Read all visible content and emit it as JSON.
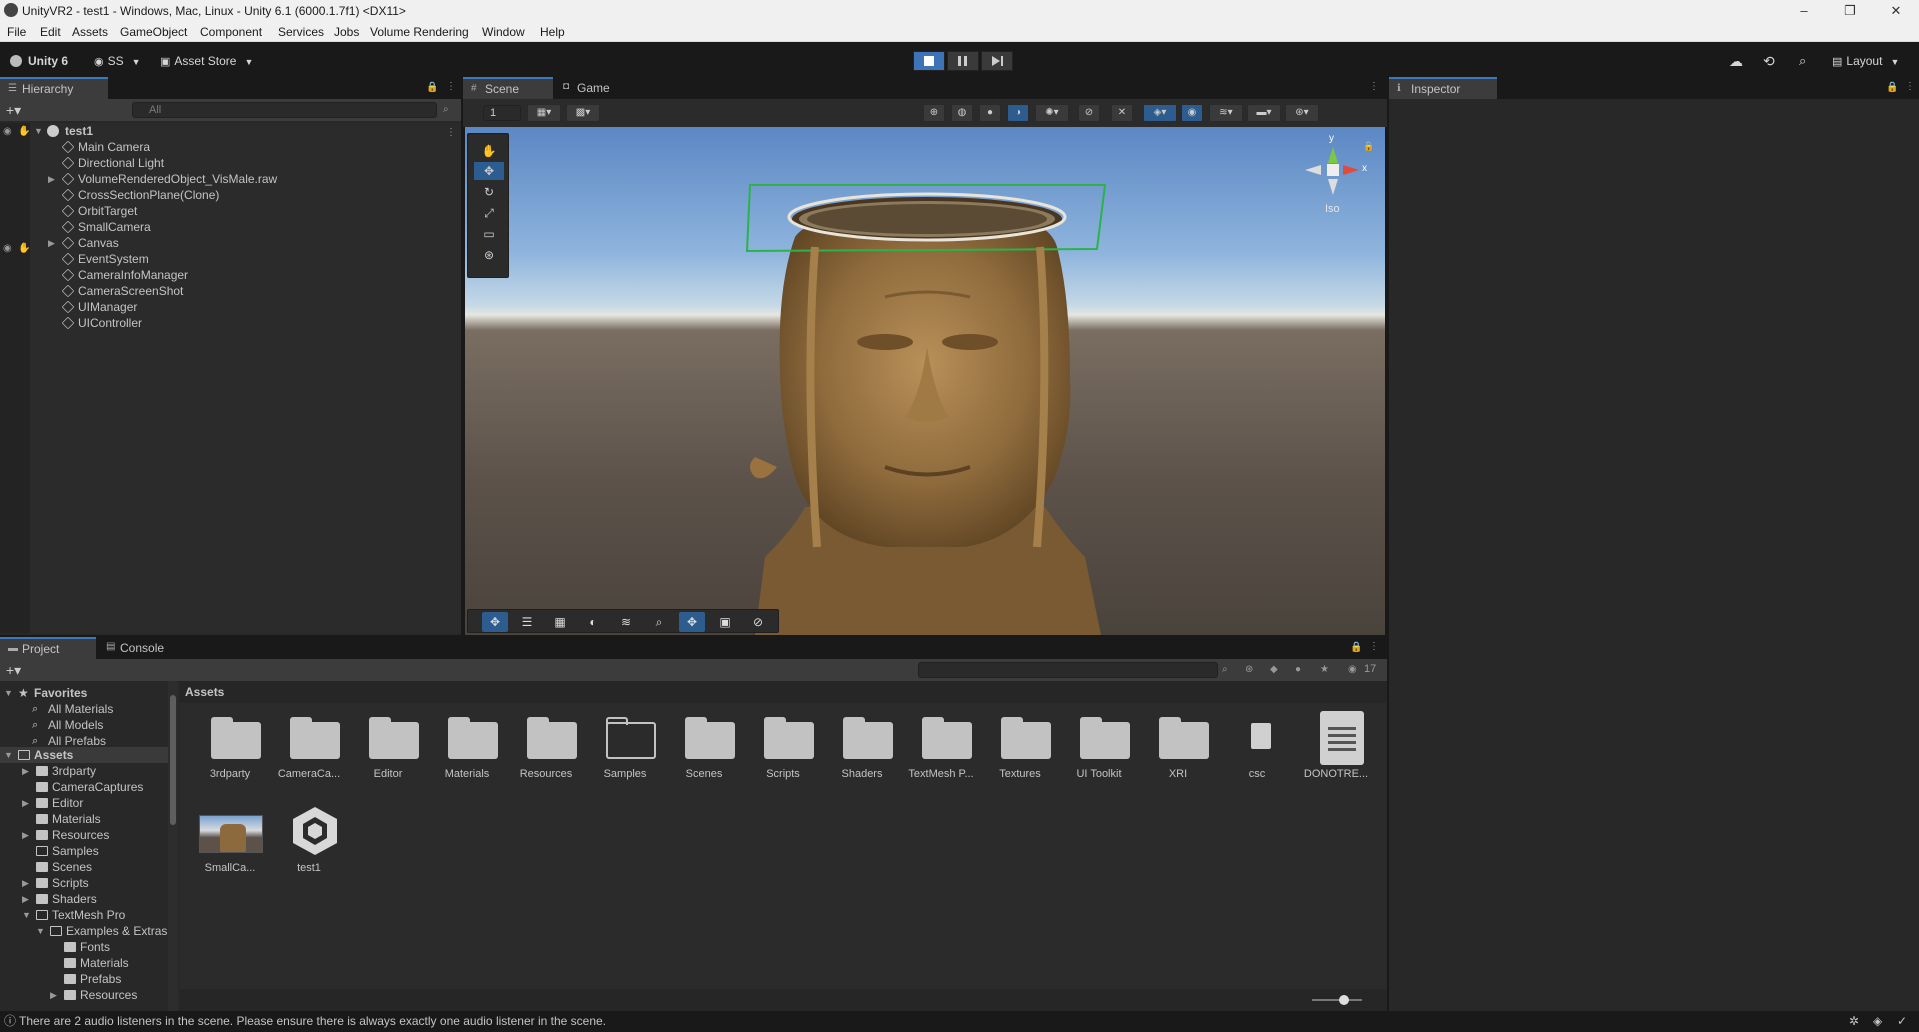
{
  "window": {
    "title": "UnityVR2 - test1 - Windows, Mac, Linux - Unity 6.1 (6000.1.7f1) <DX11>",
    "minimize": "–",
    "maximize": "❐",
    "close": "✕"
  },
  "menu": [
    "File",
    "Edit",
    "Assets",
    "GameObject",
    "Component",
    "Services",
    "Jobs",
    "Volume Rendering",
    "Window",
    "Help"
  ],
  "toolbar": {
    "unity_label": "Unity 6",
    "account_label": "SS",
    "asset_store_label": "Asset Store",
    "layout_label": "Layout"
  },
  "hierarchy": {
    "tab": "Hierarchy",
    "search_placeholder": "All",
    "scene": "test1",
    "items": [
      {
        "label": "Main Camera",
        "expandable": false
      },
      {
        "label": "Directional Light",
        "expandable": false
      },
      {
        "label": "VolumeRenderedObject_VisMale.raw",
        "expandable": true
      },
      {
        "label": "CrossSectionPlane(Clone)",
        "expandable": false
      },
      {
        "label": "OrbitTarget",
        "expandable": false
      },
      {
        "label": "SmallCamera",
        "expandable": false
      },
      {
        "label": "Canvas",
        "expandable": true
      },
      {
        "label": "EventSystem",
        "expandable": false
      },
      {
        "label": "CameraInfoManager",
        "expandable": false
      },
      {
        "label": "CameraScreenShot",
        "expandable": false
      },
      {
        "label": "UIManager",
        "expandable": false
      },
      {
        "label": "UIController",
        "expandable": false
      }
    ]
  },
  "scene": {
    "tab_scene": "Scene",
    "tab_game": "Game",
    "layer_field": "1",
    "gizmo_y": "y",
    "gizmo_x": "x",
    "gizmo_view": "Iso"
  },
  "inspector": {
    "tab": "Inspector"
  },
  "project": {
    "tab_project": "Project",
    "tab_console": "Console",
    "hidden_count": "17",
    "breadcrumb": "Assets",
    "favorites_label": "Favorites",
    "favorites": [
      "All Materials",
      "All Models",
      "All Prefabs"
    ],
    "assets_label": "Assets",
    "tree": [
      {
        "label": "3rdparty",
        "level": 1,
        "arrow": "▶",
        "open": false,
        "empty": false
      },
      {
        "label": "CameraCaptures",
        "level": 1,
        "arrow": "",
        "open": false,
        "empty": false
      },
      {
        "label": "Editor",
        "level": 1,
        "arrow": "▶",
        "open": false,
        "empty": false
      },
      {
        "label": "Materials",
        "level": 1,
        "arrow": "",
        "open": false,
        "empty": false
      },
      {
        "label": "Resources",
        "level": 1,
        "arrow": "▶",
        "open": false,
        "empty": false
      },
      {
        "label": "Samples",
        "level": 1,
        "arrow": "",
        "open": false,
        "empty": true
      },
      {
        "label": "Scenes",
        "level": 1,
        "arrow": "",
        "open": false,
        "empty": false
      },
      {
        "label": "Scripts",
        "level": 1,
        "arrow": "▶",
        "open": false,
        "empty": false
      },
      {
        "label": "Shaders",
        "level": 1,
        "arrow": "▶",
        "open": false,
        "empty": false
      },
      {
        "label": "TextMesh Pro",
        "level": 1,
        "arrow": "▼",
        "open": true,
        "empty": false
      },
      {
        "label": "Examples & Extras",
        "level": 2,
        "arrow": "▼",
        "open": true,
        "empty": false
      },
      {
        "label": "Fonts",
        "level": 3,
        "arrow": "",
        "open": false,
        "empty": false
      },
      {
        "label": "Materials",
        "level": 3,
        "arrow": "",
        "open": false,
        "empty": false
      },
      {
        "label": "Prefabs",
        "level": 3,
        "arrow": "",
        "open": false,
        "empty": false
      },
      {
        "label": "Resources",
        "level": 3,
        "arrow": "▶",
        "open": false,
        "empty": false
      }
    ],
    "assets": [
      {
        "name": "3rdparty",
        "kind": "folder"
      },
      {
        "name": "CameraCa...",
        "kind": "folder"
      },
      {
        "name": "Editor",
        "kind": "folder"
      },
      {
        "name": "Materials",
        "kind": "folder"
      },
      {
        "name": "Resources",
        "kind": "folder"
      },
      {
        "name": "Samples",
        "kind": "folder-empty"
      },
      {
        "name": "Scenes",
        "kind": "folder"
      },
      {
        "name": "Scripts",
        "kind": "folder"
      },
      {
        "name": "Shaders",
        "kind": "folder"
      },
      {
        "name": "TextMesh P...",
        "kind": "folder"
      },
      {
        "name": "Textures",
        "kind": "folder"
      },
      {
        "name": "UI Toolkit",
        "kind": "folder"
      },
      {
        "name": "XRI",
        "kind": "folder"
      },
      {
        "name": "csc",
        "kind": "file"
      },
      {
        "name": "DONOTRE...",
        "kind": "text-file"
      },
      {
        "name": "SmallCa...",
        "kind": "render-texture"
      },
      {
        "name": "test1",
        "kind": "unity-scene"
      }
    ]
  },
  "status": {
    "message": "There are 2 audio listeners in the scene. Please ensure there is always exactly one audio listener in the scene."
  },
  "colors": {
    "accent": "#3a79bb",
    "play_active": "#3d74b8",
    "panel": "#282828",
    "dark": "#191919",
    "cross_section_outline": "#2bb34a"
  }
}
